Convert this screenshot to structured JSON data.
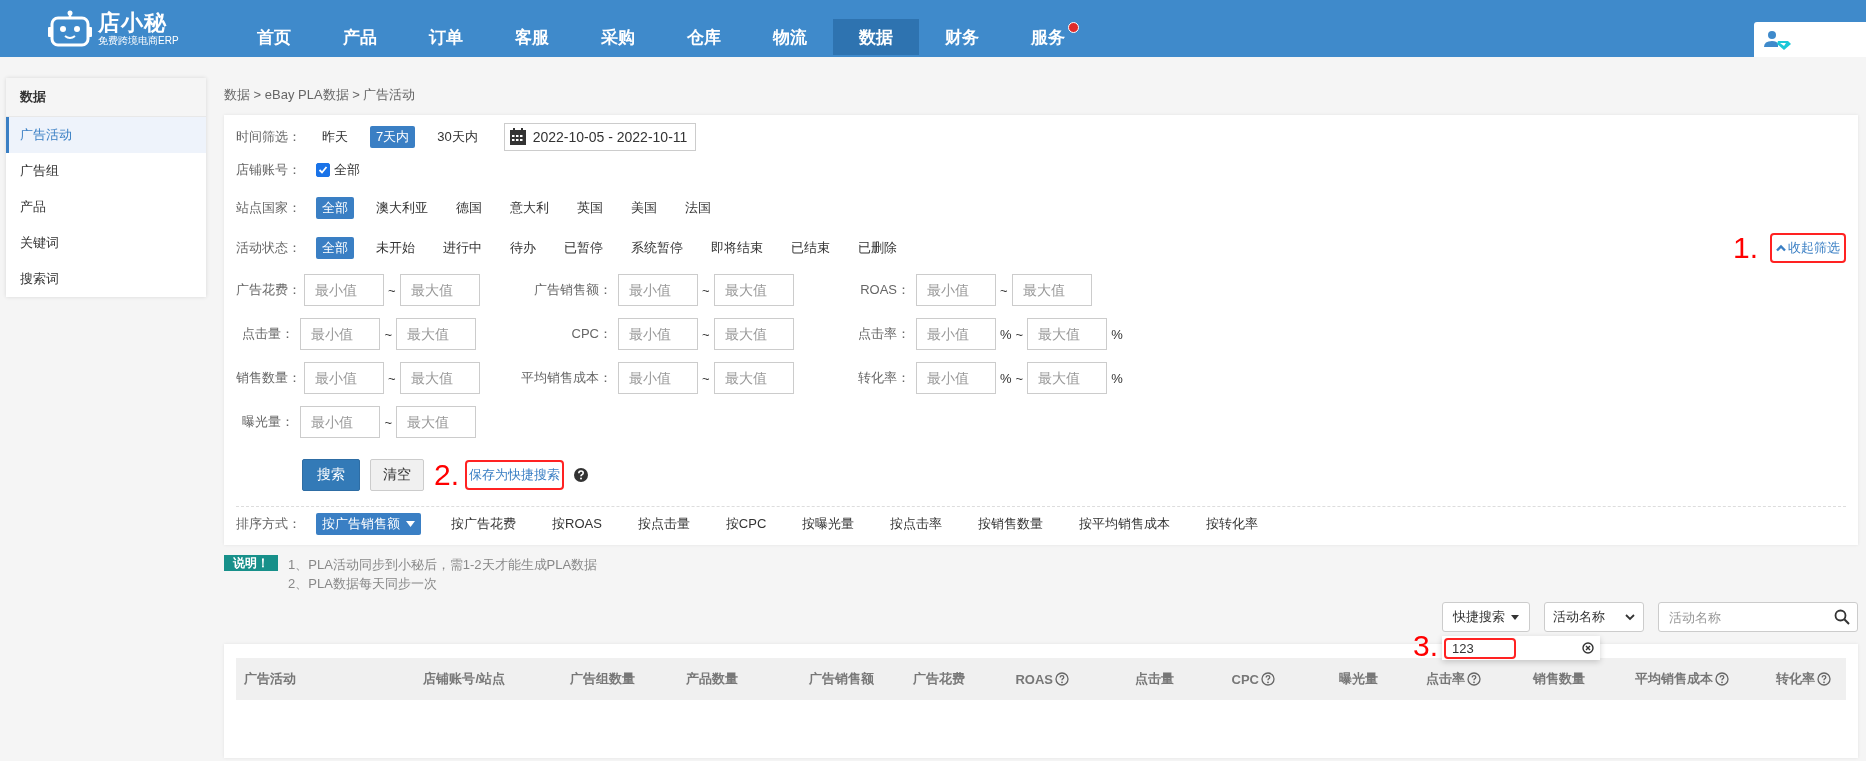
{
  "logo": {
    "name": "店小秘",
    "tagline": "免费跨境电商ERP"
  },
  "nav": [
    {
      "label": "首页",
      "selected": false,
      "badge_dot": false
    },
    {
      "label": "产品",
      "selected": false,
      "badge_dot": false
    },
    {
      "label": "订单",
      "selected": false,
      "badge_dot": false
    },
    {
      "label": "客服",
      "selected": false,
      "badge_dot": false
    },
    {
      "label": "采购",
      "selected": false,
      "badge_dot": false
    },
    {
      "label": "仓库",
      "selected": false,
      "badge_dot": false
    },
    {
      "label": "物流",
      "selected": false,
      "badge_dot": false
    },
    {
      "label": "数据",
      "selected": true,
      "badge_dot": false
    },
    {
      "label": "财务",
      "selected": false,
      "badge_dot": false
    },
    {
      "label": "服务",
      "selected": false,
      "badge_dot": true
    }
  ],
  "sidebar": {
    "title": "数据",
    "items": [
      {
        "label": "广告活动",
        "selected": true
      },
      {
        "label": "广告组",
        "selected": false
      },
      {
        "label": "产品",
        "selected": false
      },
      {
        "label": "关键词",
        "selected": false
      },
      {
        "label": "搜索词",
        "selected": false
      }
    ]
  },
  "breadcrumb": "数据 > eBay PLA数据 > 广告活动",
  "filters": {
    "time": {
      "label": "时间筛选：",
      "options": [
        {
          "label": "昨天",
          "selected": false
        },
        {
          "label": "7天内",
          "selected": true
        },
        {
          "label": "30天内",
          "selected": false
        }
      ],
      "date_range": "2022-10-05 - 2022-10-11"
    },
    "store": {
      "label": "店铺账号：",
      "option": {
        "label": "全部",
        "checked": true
      }
    },
    "site": {
      "label": "站点国家：",
      "options": [
        {
          "label": "全部",
          "selected": true
        },
        {
          "label": "澳大利亚",
          "selected": false
        },
        {
          "label": "德国",
          "selected": false
        },
        {
          "label": "意大利",
          "selected": false
        },
        {
          "label": "英国",
          "selected": false
        },
        {
          "label": "美国",
          "selected": false
        },
        {
          "label": "法国",
          "selected": false
        }
      ]
    },
    "status": {
      "label": "活动状态：",
      "options": [
        {
          "label": "全部",
          "selected": true
        },
        {
          "label": "未开始",
          "selected": false
        },
        {
          "label": "进行中",
          "selected": false
        },
        {
          "label": "待办",
          "selected": false
        },
        {
          "label": "已暂停",
          "selected": false
        },
        {
          "label": "系统暂停",
          "selected": false
        },
        {
          "label": "即将结束",
          "selected": false
        },
        {
          "label": "已结束",
          "selected": false
        },
        {
          "label": "已删除",
          "selected": false
        }
      ]
    },
    "collapse": {
      "label": "收起筛选",
      "callout": "1."
    },
    "ranges": [
      [
        {
          "label": "广告花费：",
          "min_placeholder": "最小值",
          "separator": "~",
          "max_placeholder": "最大值"
        },
        {
          "label": "广告销售额：",
          "min_placeholder": "最小值",
          "separator": "~",
          "max_placeholder": "最大值"
        },
        {
          "label": "ROAS：",
          "min_placeholder": "最小值",
          "separator": "~",
          "max_placeholder": "最大值"
        }
      ],
      [
        {
          "label": "点击量：",
          "min_placeholder": "最小值",
          "separator": "~",
          "max_placeholder": "最大值"
        },
        {
          "label": "CPC：",
          "min_placeholder": "最小值",
          "separator": "~",
          "max_placeholder": "最大值"
        },
        {
          "label": "点击率：",
          "min_placeholder": "最小值",
          "min_unit": "%",
          "separator": "~",
          "max_placeholder": "最大值",
          "max_unit": "%"
        }
      ],
      [
        {
          "label": "销售数量：",
          "min_placeholder": "最小值",
          "separator": "~",
          "max_placeholder": "最大值"
        },
        {
          "label": "平均销售成本：",
          "min_placeholder": "最小值",
          "separator": "~",
          "max_placeholder": "最大值"
        },
        {
          "label": "转化率：",
          "min_placeholder": "最小值",
          "min_unit": "%",
          "separator": "~",
          "max_placeholder": "最大值",
          "max_unit": "%"
        }
      ],
      [
        {
          "label": "曝光量：",
          "min_placeholder": "最小值",
          "separator": "~",
          "max_placeholder": "最大值"
        }
      ]
    ]
  },
  "actions": {
    "search": "搜索",
    "clear": "清空",
    "save_quick": {
      "label": "保存为快捷搜索",
      "callout": "2."
    }
  },
  "sort": {
    "label": "排序方式：",
    "options": [
      {
        "label": "按广告销售额",
        "selected": true
      },
      {
        "label": "按广告花费",
        "selected": false
      },
      {
        "label": "按ROAS",
        "selected": false
      },
      {
        "label": "按点击量",
        "selected": false
      },
      {
        "label": "按CPC",
        "selected": false
      },
      {
        "label": "按曝光量",
        "selected": false
      },
      {
        "label": "按点击率",
        "selected": false
      },
      {
        "label": "按销售数量",
        "selected": false
      },
      {
        "label": "按平均销售成本",
        "selected": false
      },
      {
        "label": "按转化率",
        "selected": false
      }
    ]
  },
  "notice": {
    "badge": "说明！",
    "lines": [
      "1、PLA活动同步到小秘后，需1-2天才能生成PLA数据",
      "2、PLA数据每天同步一次"
    ]
  },
  "quick_search": {
    "button": "快捷搜索",
    "field_select": "活动名称",
    "search_placeholder": "活动名称",
    "menu_items": [
      {
        "label": "123",
        "callout": "3."
      }
    ]
  },
  "table": {
    "columns": [
      {
        "label": "广告活动",
        "help": false
      },
      {
        "label": "店铺账号/站点",
        "help": false
      },
      {
        "label": "广告组数量",
        "help": false
      },
      {
        "label": "产品数量",
        "help": false
      },
      {
        "label": "广告销售额",
        "help": false
      },
      {
        "label": "广告花费",
        "help": false
      },
      {
        "label": "ROAS",
        "help": true
      },
      {
        "label": "点击量",
        "help": false
      },
      {
        "label": "CPC",
        "help": true
      },
      {
        "label": "曝光量",
        "help": false
      },
      {
        "label": "点击率",
        "help": true
      },
      {
        "label": "销售数量",
        "help": false
      },
      {
        "label": "平均销售成本",
        "help": true
      },
      {
        "label": "转化率",
        "help": true
      }
    ]
  }
}
